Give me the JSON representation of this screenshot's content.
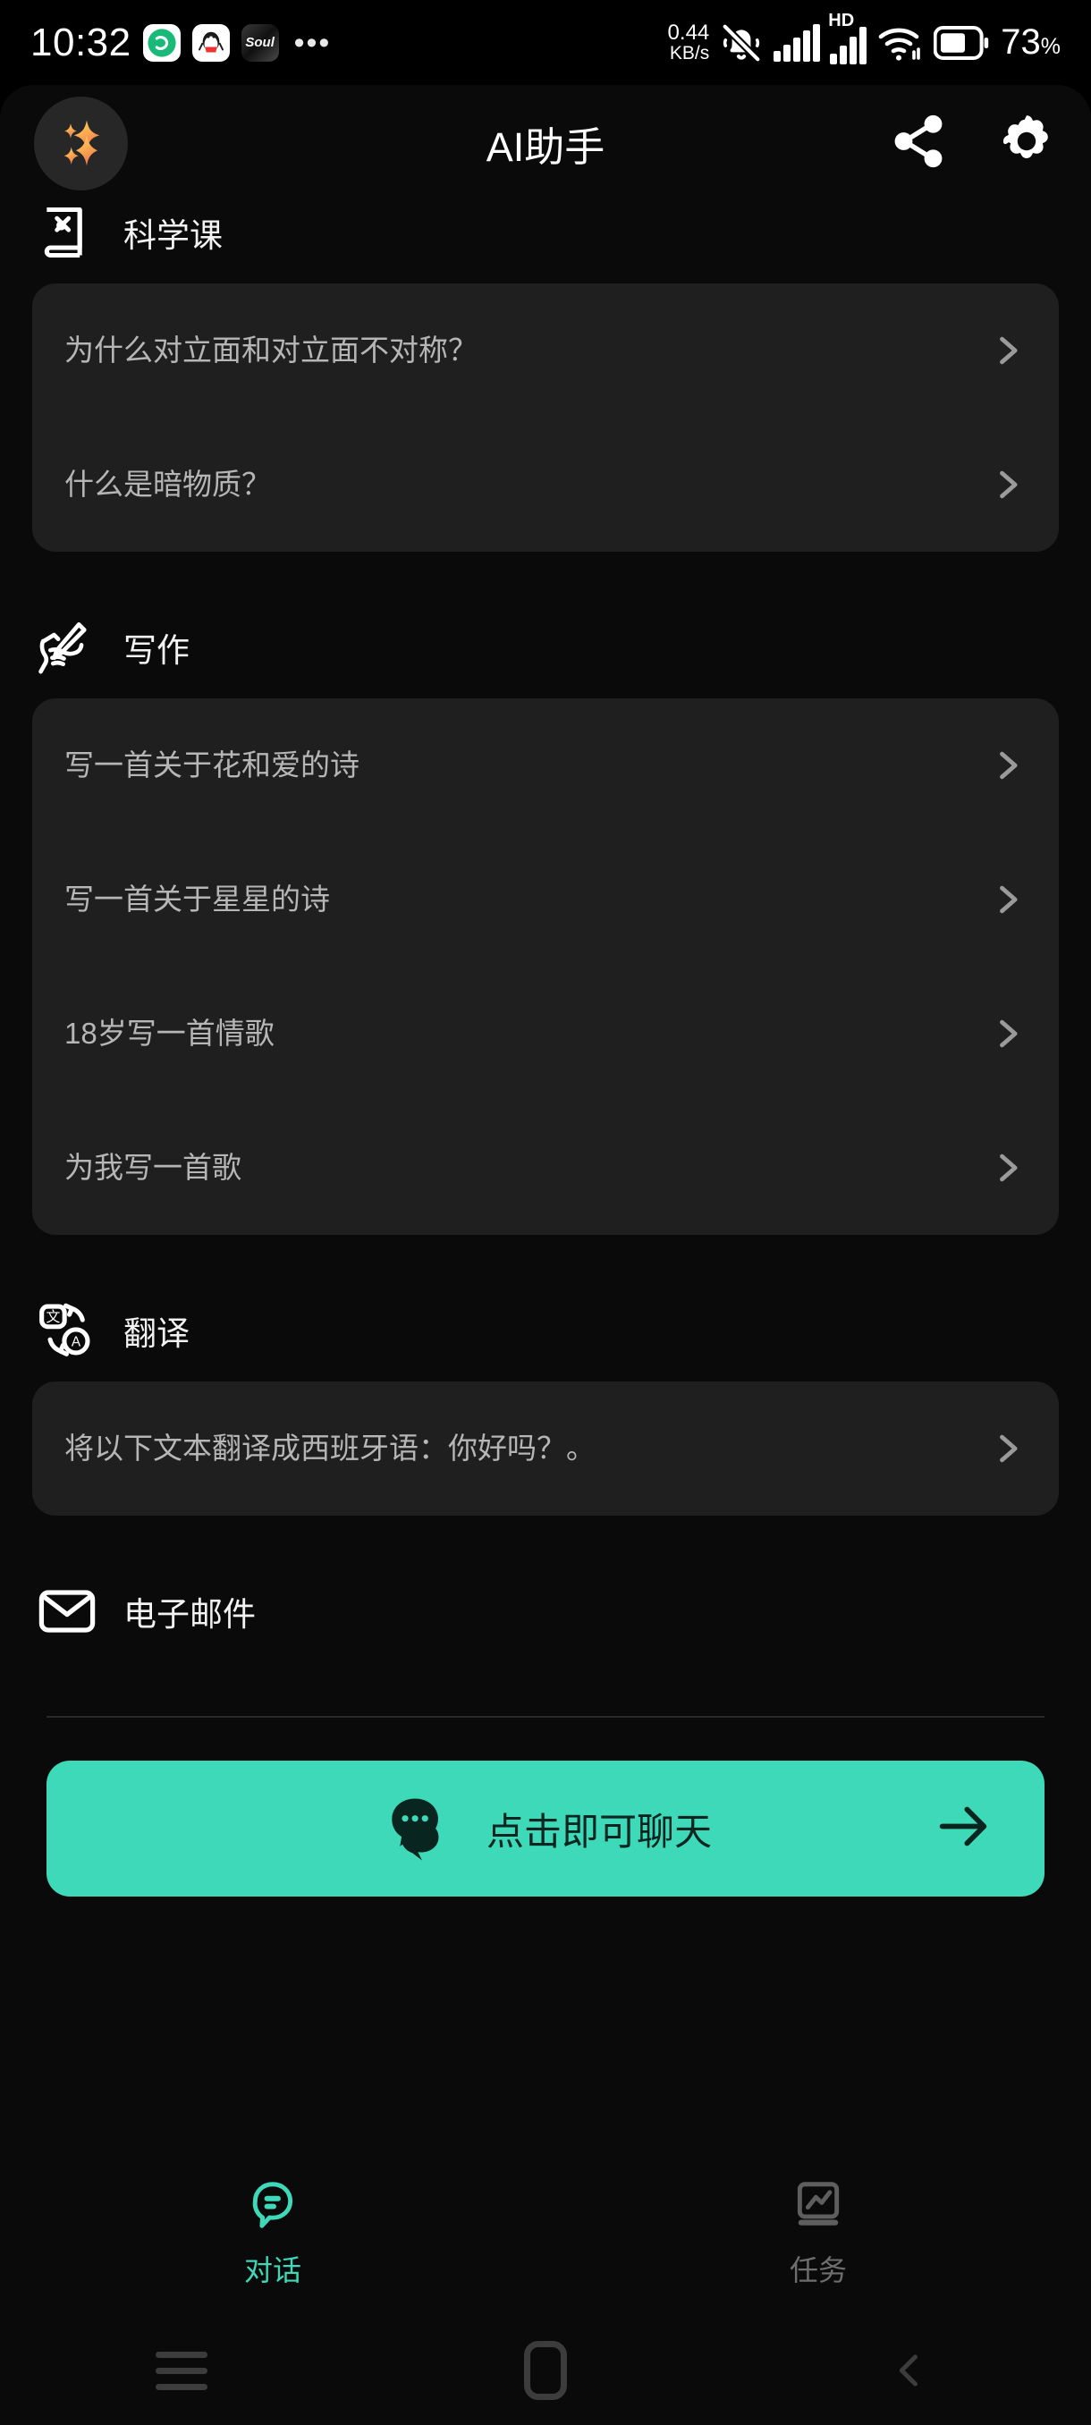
{
  "status_bar": {
    "time": "10:32",
    "app_icons": [
      {
        "name": "wechat-icon",
        "label": "↻"
      },
      {
        "name": "qq-icon",
        "label": "🐧"
      },
      {
        "name": "soul-icon",
        "label": "Soul"
      }
    ],
    "overflow": "•••",
    "net_speed_value": "0.44",
    "net_speed_unit": "KB/s",
    "mute_icon": "bell-off-icon",
    "signal_icon": "signal-bars-icon",
    "hd_label": "HD",
    "wifi_icon": "wifi-icon",
    "battery_percent": "73",
    "battery_percent_symbol": "%"
  },
  "header": {
    "title": "AI助手",
    "avatar_icon": "sparkles-icon",
    "share_icon": "share-icon",
    "settings_icon": "gear-icon"
  },
  "sections": [
    {
      "id": "science",
      "title": "科学课",
      "icon": "book-atom-icon",
      "items": [
        "为什么对立面和对立面不对称？",
        "什么是暗物质？"
      ]
    },
    {
      "id": "writing",
      "title": "写作",
      "icon": "hand-writing-icon",
      "items": [
        "写一首关于花和爱的诗",
        "写一首关于星星的诗",
        "18岁写一首情歌",
        "为我写一首歌"
      ]
    },
    {
      "id": "translate",
      "title": "翻译",
      "icon": "translate-icon",
      "items": [
        "将以下文本翻译成西班牙语：你好吗？。"
      ]
    },
    {
      "id": "email",
      "title": "电子邮件",
      "icon": "envelope-icon",
      "items": []
    }
  ],
  "chevron_icon": "chevron-right-icon",
  "cta": {
    "label": "点击即可聊天",
    "chat_icon": "chat-bubble-icon",
    "arrow_icon": "arrow-right-icon"
  },
  "tabs": [
    {
      "id": "chat",
      "label": "对话",
      "icon": "chat-outline-icon",
      "active": true
    },
    {
      "id": "tasks",
      "label": "任务",
      "icon": "chart-screen-icon",
      "active": false
    }
  ],
  "android_nav": [
    {
      "id": "recents",
      "icon": "menu-icon"
    },
    {
      "id": "home",
      "icon": "home-square-icon"
    },
    {
      "id": "back",
      "icon": "back-chevron-icon"
    }
  ],
  "colors": {
    "accent": "#3dd9b8",
    "background": "#000000",
    "surface": "#0a0a0a",
    "card": "#1f1f1f",
    "text_primary": "#f2f2f2",
    "text_secondary": "#b6b6b6",
    "text_muted": "#6e6e6e"
  }
}
